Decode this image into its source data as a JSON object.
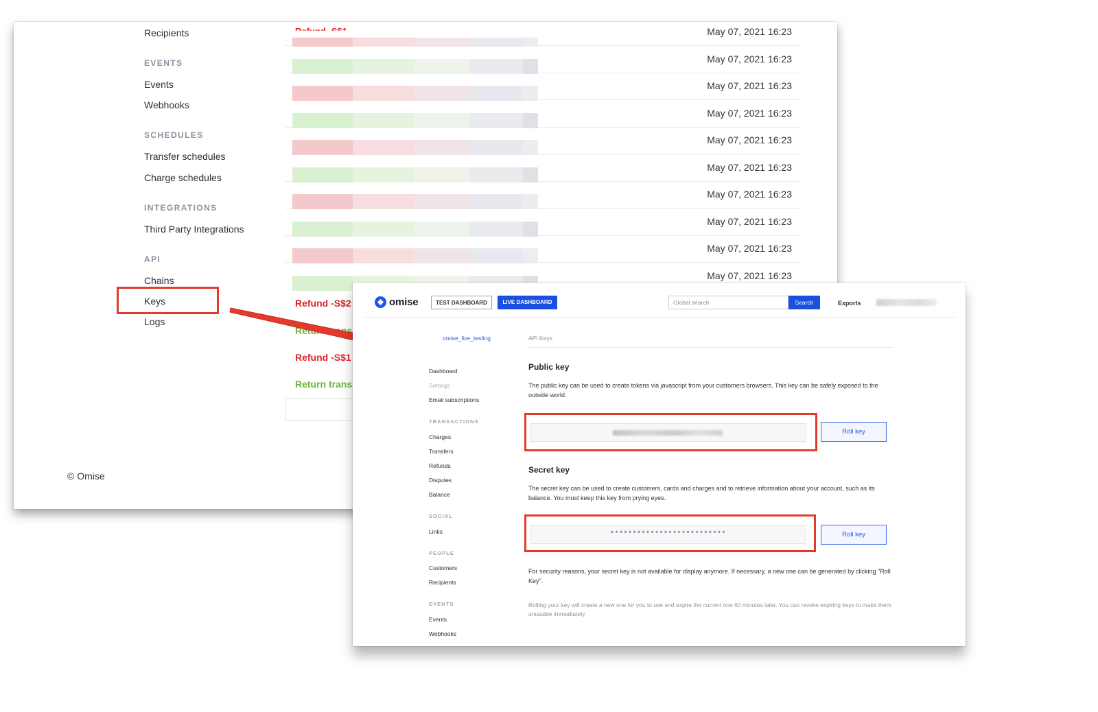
{
  "back_sidebar": {
    "recipients": "Recipients",
    "events_group": "EVENTS",
    "events": "Events",
    "webhooks": "Webhooks",
    "schedules_group": "SCHEDULES",
    "transfer_schedules": "Transfer schedules",
    "charge_schedules": "Charge schedules",
    "integrations_group": "INTEGRATIONS",
    "third_party": "Third Party Integrations",
    "api_group": "API",
    "chains": "Chains",
    "keys": "Keys",
    "logs": "Logs"
  },
  "back_footer": {
    "copyright": "© Omise"
  },
  "back_table": {
    "first_row_partial": "Refund -S$1",
    "dates": [
      "May 07, 2021 16:23",
      "May 07, 2021 16:23",
      "May 07, 2021 16:23",
      "May 07, 2021 16:23",
      "May 07, 2021 16:23",
      "May 07, 2021 16:23",
      "May 07, 2021 16:23",
      "May 07, 2021 16:23",
      "May 07, 2021 16:23",
      "May 07, 2021 16:23"
    ],
    "lower_rows": [
      {
        "label": "Refund -S$2",
        "status": "refund"
      },
      {
        "label": "Return transa",
        "status": "return"
      },
      {
        "label": "Refund -S$1",
        "status": "refund"
      },
      {
        "label": "Return transa",
        "status": "return"
      }
    ]
  },
  "front": {
    "brand": "omise",
    "test_dashboard": "TEST DASHBOARD",
    "live_dashboard": "LIVE DASHBOARD",
    "search_placeholder": "Global search",
    "search_button": "Search",
    "exports": "Exports",
    "account_name": "omise_live_testing",
    "sidebar": {
      "dashboard": "Dashboard",
      "settings": "Settings",
      "email_subscriptions": "Email subscriptions",
      "transactions_group": "TRANSACTIONS",
      "charges": "Charges",
      "transfers": "Transfers",
      "refunds": "Refunds",
      "disputes": "Disputes",
      "balance": "Balance",
      "social_group": "SOCIAL",
      "links": "Links",
      "people_group": "PEOPLE",
      "customers": "Customers",
      "recipients": "Recipients",
      "events_group": "EVENTS",
      "events": "Events",
      "webhooks": "Webhooks"
    },
    "breadcrumb": "API Keys",
    "public_key": {
      "title": "Public key",
      "description": "The public key can be used to create tokens via javascript from your customers browsers. This key can be safely exposed to the outside world.",
      "roll_label": "Roll key"
    },
    "secret_key": {
      "title": "Secret key",
      "description": "The secret key can be used to create customers, cards and charges and to retrieve information about your account, such as its balance. You must keep this key from prying eyes.",
      "masked_value": "**************************",
      "roll_label": "Roll key"
    },
    "security_note": "For security reasons, your secret key is not available for display anymore. If necessary, a new one can be generated by clicking \"Roll Key\".",
    "rolling_note": "Rolling your key will create a new one for you to use and expire the current one 60 minutes later. You can revoke expiring keys to make them unusable immediately."
  },
  "colors": {
    "annotation_red": "#e33a2b",
    "brand_blue": "#1a4fe0",
    "refund_red": "#e0232b",
    "return_green": "#6cb33d"
  }
}
